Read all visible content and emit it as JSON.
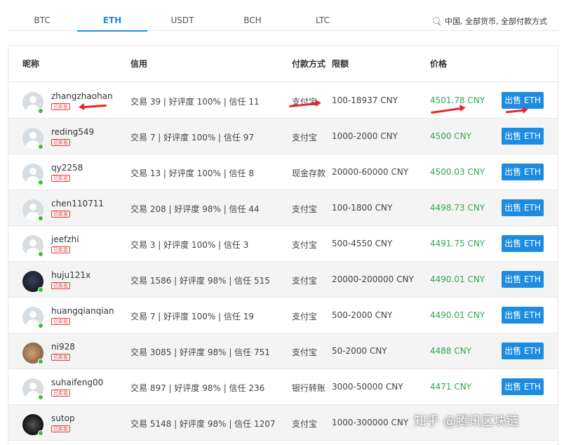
{
  "tabs": [
    {
      "label": "BTC",
      "active": false
    },
    {
      "label": "ETH",
      "active": true
    },
    {
      "label": "USDT",
      "active": false
    },
    {
      "label": "BCH",
      "active": false
    },
    {
      "label": "LTC",
      "active": false
    }
  ],
  "filter": {
    "text": "中国, 全部货币, 全部付款方式",
    "icon": "search-icon"
  },
  "columns": {
    "nickname": "昵称",
    "credit": "信用",
    "payment": "付款方式",
    "limit": "限额",
    "price": "价格"
  },
  "badge_label": "已实名",
  "rows": [
    {
      "name": "zhangzhaohan",
      "credit": "交易 39 | 好评度 100% | 信任 11",
      "payment": "支付宝",
      "limit": "100-18937 CNY",
      "price": "4501.78 CNY",
      "action": "出售 ETH",
      "avatar": "default"
    },
    {
      "name": "reding549",
      "credit": "交易 7 | 好评度 100% | 信任 97",
      "payment": "支付宝",
      "limit": "1000-2000 CNY",
      "price": "4500 CNY",
      "action": "出售 ETH",
      "avatar": "default"
    },
    {
      "name": "qy2258",
      "credit": "交易 13 | 好评度 100% | 信任 8",
      "payment": "现金存款",
      "limit": "20000-60000 CNY",
      "price": "4500.03 CNY",
      "action": "出售 ETH",
      "avatar": "default"
    },
    {
      "name": "chen110711",
      "credit": "交易 208 | 好评度 98% | 信任 44",
      "payment": "支付宝",
      "limit": "100-1800 CNY",
      "price": "4498.73 CNY",
      "action": "出售 ETH",
      "avatar": "default"
    },
    {
      "name": "jeefzhi",
      "credit": "交易 3 | 好评度 100% | 信任 3",
      "payment": "支付宝",
      "limit": "500-4550 CNY",
      "price": "4491.75 CNY",
      "action": "出售 ETH",
      "avatar": "default"
    },
    {
      "name": "huju121x",
      "credit": "交易 1586 | 好评度 98% | 信任 515",
      "payment": "支付宝",
      "limit": "20000-200000 CNY",
      "price": "4490.01 CNY",
      "action": "出售 ETH",
      "avatar": "photo-dark"
    },
    {
      "name": "huangqianqian",
      "credit": "交易 7 | 好评度 100% | 信任 19",
      "payment": "支付宝",
      "limit": "500-2000 CNY",
      "price": "4490.01 CNY",
      "action": "出售 ETH",
      "avatar": "default"
    },
    {
      "name": "ni928",
      "credit": "交易 3085 | 好评度 98% | 信任 751",
      "payment": "支付宝",
      "limit": "50-2000 CNY",
      "price": "4488 CNY",
      "action": "出售 ETH",
      "avatar": "photo-warm"
    },
    {
      "name": "suhaifeng00",
      "credit": "交易 897 | 好评度 98% | 信任 236",
      "payment": "银行转账",
      "limit": "3000-50000 CNY",
      "price": "4471 CNY",
      "action": "出售 ETH",
      "avatar": "default"
    },
    {
      "name": "sutop",
      "credit": "交易 5148 | 好评度 98% | 信任 1207",
      "payment": "支付宝",
      "limit": "1000-300000 CNY",
      "price": "",
      "action": "",
      "avatar": "photo-black"
    }
  ],
  "watermark": "知乎 @腾讯区块链",
  "colors": {
    "accent": "#1d8ce0",
    "price": "#2fa84f",
    "badge": "#e03c3c",
    "annotation": "#e8262a"
  }
}
